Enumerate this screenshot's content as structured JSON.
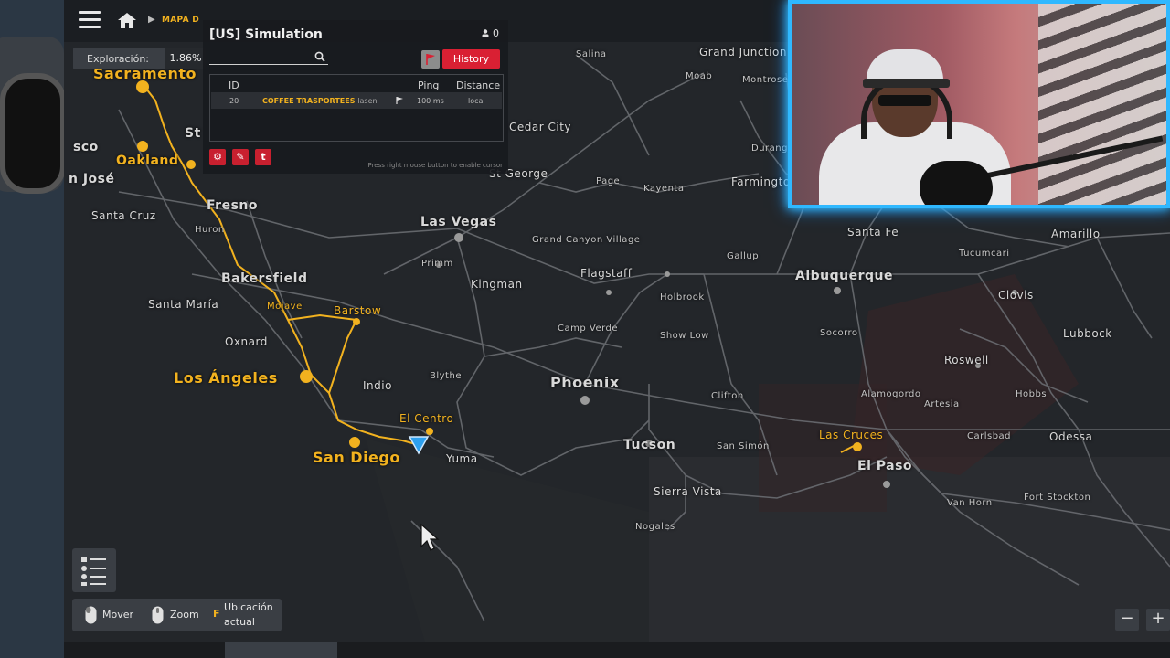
{
  "breadcrumb": {
    "label": "MAPA D"
  },
  "exploration": {
    "label": "Exploración:",
    "value": "1.86%"
  },
  "server_panel": {
    "title": "[US] Simulation",
    "player_count": "0",
    "history_label": "History",
    "columns": {
      "id": "ID",
      "ping": "Ping",
      "distance": "Distance"
    },
    "row": {
      "id": "20",
      "company": "COFFEE TRASPORTEES",
      "name": "lasen",
      "ping": "100 ms",
      "distance": "local"
    },
    "hint": "Press right mouse button to enable cursor",
    "tool_buttons": [
      "⚙",
      "✎",
      "t"
    ]
  },
  "controls": {
    "move": "Mover",
    "zoom": "Zoom",
    "key": "F",
    "location_line1": "Ubicación",
    "location_line2": "actual"
  },
  "zoom": {
    "minus": "−",
    "plus": "+"
  },
  "colors": {
    "route": "#f2b21f",
    "history_button": "#d92033",
    "webcam_glow": "#2fb8ff"
  },
  "cities": [
    {
      "name": "Sacramento",
      "style": "gold huge"
    },
    {
      "name": "Oakland",
      "style": "gold big"
    },
    {
      "name": "sco",
      "style": "big"
    },
    {
      "name": "St",
      "style": "big"
    },
    {
      "name": "n José",
      "style": "big"
    },
    {
      "name": "Santa Cruz",
      "style": "med"
    },
    {
      "name": "Fresno",
      "style": "big"
    },
    {
      "name": "Huron",
      "style": "small"
    },
    {
      "name": "Bakersfield",
      "style": "big"
    },
    {
      "name": "Santa María",
      "style": "med"
    },
    {
      "name": "Mojave",
      "style": "gold small"
    },
    {
      "name": "Barstow",
      "style": "gold med"
    },
    {
      "name": "Oxnard",
      "style": "med"
    },
    {
      "name": "Los Ángeles",
      "style": "gold huge"
    },
    {
      "name": "Indio",
      "style": "med"
    },
    {
      "name": "Blythe",
      "style": "small"
    },
    {
      "name": "El Centro",
      "style": "gold med"
    },
    {
      "name": "San Diego",
      "style": "gold huge"
    },
    {
      "name": "Yuma",
      "style": "med"
    },
    {
      "name": "Las Vegas",
      "style": "big"
    },
    {
      "name": "Primm",
      "style": "small"
    },
    {
      "name": "Kingman",
      "style": "med"
    },
    {
      "name": "Salina",
      "style": "small"
    },
    {
      "name": "Cedar City",
      "style": "med"
    },
    {
      "name": "St George",
      "style": "med"
    },
    {
      "name": "Page",
      "style": "small"
    },
    {
      "name": "Kayenta",
      "style": "small"
    },
    {
      "name": "Grand Canyon Village",
      "style": "small"
    },
    {
      "name": "Flagstaff",
      "style": "med"
    },
    {
      "name": "Holbrook",
      "style": "small"
    },
    {
      "name": "Camp Verde",
      "style": "small"
    },
    {
      "name": "Show Low",
      "style": "small"
    },
    {
      "name": "Phoenix",
      "style": "huge"
    },
    {
      "name": "Clifton",
      "style": "small"
    },
    {
      "name": "Tucson",
      "style": "big"
    },
    {
      "name": "San Simón",
      "style": "small"
    },
    {
      "name": "Sierra Vista",
      "style": "med"
    },
    {
      "name": "Nogales",
      "style": "small"
    },
    {
      "name": "Grand Junction",
      "style": "med"
    },
    {
      "name": "Moab",
      "style": "small"
    },
    {
      "name": "Montrose",
      "style": "small"
    },
    {
      "name": "Durango",
      "style": "small"
    },
    {
      "name": "Farmington",
      "style": "med"
    },
    {
      "name": "Gallup",
      "style": "small"
    },
    {
      "name": "Santa Fe",
      "style": "med"
    },
    {
      "name": "Albuquerque",
      "style": "big"
    },
    {
      "name": "Socorro",
      "style": "small"
    },
    {
      "name": "Tucumcari",
      "style": "small"
    },
    {
      "name": "Amarillo",
      "style": "med"
    },
    {
      "name": "Clovis",
      "style": "med"
    },
    {
      "name": "Roswell",
      "style": "med"
    },
    {
      "name": "Lubbock",
      "style": "med"
    },
    {
      "name": "Alamogordo",
      "style": "small"
    },
    {
      "name": "Artesia",
      "style": "small"
    },
    {
      "name": "Hobbs",
      "style": "small"
    },
    {
      "name": "Las Cruces",
      "style": "gold med"
    },
    {
      "name": "El Paso",
      "style": "big"
    },
    {
      "name": "Carlsbad",
      "style": "small"
    },
    {
      "name": "Odessa",
      "style": "med"
    },
    {
      "name": "Van Horn",
      "style": "small"
    },
    {
      "name": "Fort Stockton",
      "style": "small"
    }
  ]
}
